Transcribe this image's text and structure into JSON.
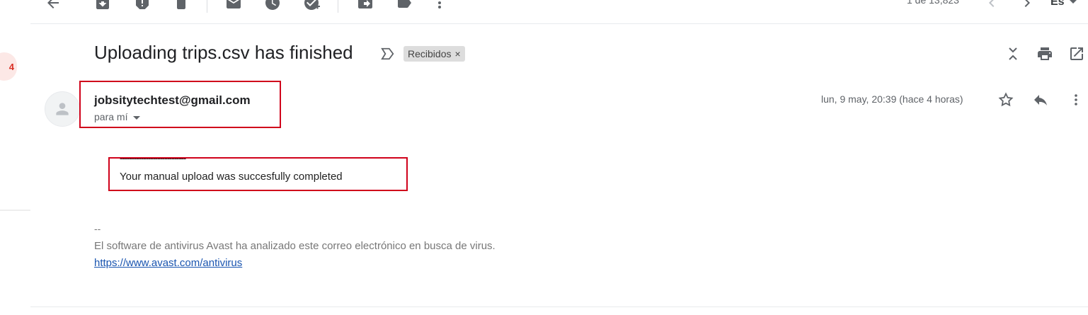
{
  "toolbar": {
    "icons": [
      "back-arrow-icon",
      "archive-icon",
      "report-spam-icon",
      "delete-icon",
      "mark-unread-icon",
      "snooze-icon",
      "add-to-tasks-icon",
      "move-to-icon",
      "labels-icon",
      "more-vert-icon"
    ],
    "pager": "1 de 13,823",
    "lang": "Es"
  },
  "sidebar": {
    "badge_count": "4"
  },
  "email": {
    "subject": "Uploading trips.csv has finished",
    "label": "Recibidos",
    "label_remove": "×",
    "sender": "jobsitytechtest@gmail.com",
    "to_me": "para mí",
    "datetime": "lun, 9 may, 20:39 (hace 4 horas)",
    "body_dashes": "----------------------------",
    "body_message": "Your manual upload was succesfully completed",
    "signature_sep": "--",
    "signature_text": "El software de antivirus Avast ha analizado este correo electrónico en busca de virus.",
    "signature_link": "https://www.avast.com/antivirus"
  },
  "colors": {
    "highlight_box": "#d0021b",
    "link": "#1a55b0",
    "badge_text": "#d93025",
    "badge_bg": "#fce8e6"
  }
}
